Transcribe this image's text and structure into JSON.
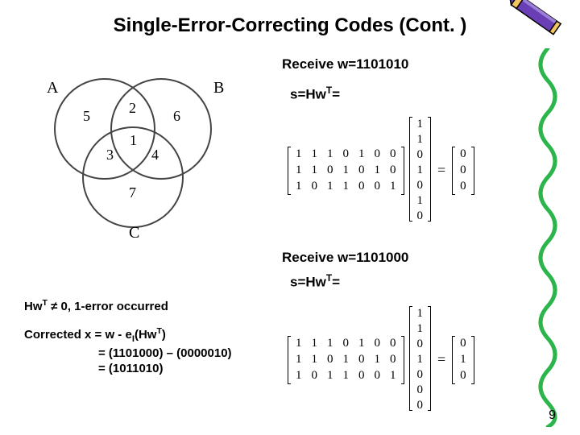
{
  "title": "Single-Error-Correcting Codes (Cont. )",
  "venn": {
    "A": "A",
    "B": "B",
    "C": "C",
    "r1": "5",
    "r2": "2",
    "r3": "6",
    "r4": "3",
    "r5": "1",
    "r6": "4",
    "r7": "7"
  },
  "receive1": "Receive w=1101010",
  "eq1_pre": "s=Hw",
  "eq1_sup": "T",
  "eq1_post": "=",
  "H": [
    [
      "1",
      "1",
      "1",
      "0",
      "1",
      "0",
      "0"
    ],
    [
      "1",
      "1",
      "0",
      "1",
      "0",
      "1",
      "0"
    ],
    [
      "1",
      "0",
      "1",
      "1",
      "0",
      "0",
      "1"
    ]
  ],
  "w1": [
    "1",
    "1",
    "0",
    "1",
    "0",
    "1",
    "0"
  ],
  "res1": [
    "0",
    "0",
    "0"
  ],
  "receive2": "Receive w=1101000",
  "eq2_pre": "s=Hw",
  "eq2_sup": "T",
  "eq2_post": "=",
  "w2": [
    "1",
    "1",
    "0",
    "1",
    "0",
    "0",
    "0"
  ],
  "res2": [
    "0",
    "1",
    "0"
  ],
  "err_pre": "Hw",
  "err_sup": "T",
  "err_post": " ≠ 0, 1-error occurred",
  "corr_l1_a": "Corrected x = w - e",
  "corr_l1_b": "I",
  "corr_l1_c": "(Hw",
  "corr_l1_d": "T",
  "corr_l1_e": ")",
  "corr_l2": "= (1101000) – (0000010)",
  "corr_l3": "= (1011010)",
  "pagenum": "9"
}
